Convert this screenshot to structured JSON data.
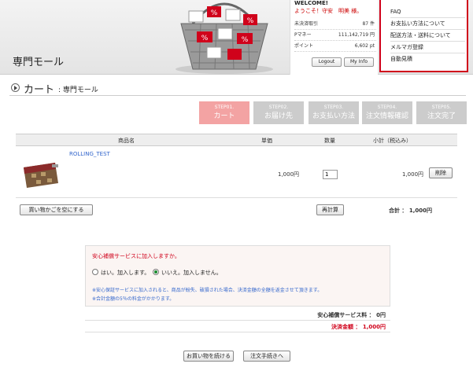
{
  "header": {
    "brand": "専門モール",
    "welcome_title": "WELCOME!",
    "welcome_user": "ようこそ！守安　明美 様。",
    "stats": [
      {
        "label": "未決済取引",
        "value": "87 件"
      },
      {
        "label": "Pマネー",
        "value": "111,142,719 円"
      },
      {
        "label": "ポイント",
        "value": "6,602 pt"
      }
    ],
    "logout_label": "Logout",
    "myinfo_label": "My Info"
  },
  "menu": {
    "items": [
      "FAQ",
      "お支払い方法について",
      "配送方法・送料について",
      "メルマガ登録",
      "自動見積"
    ]
  },
  "page": {
    "title": "カート",
    "subtitle": ": 専門モール"
  },
  "steps": [
    {
      "num": "STEP01.",
      "label": "カート",
      "active": true
    },
    {
      "num": "STEP02.",
      "label": "お届け先",
      "active": false
    },
    {
      "num": "STEP03.",
      "label": "お支払い方法",
      "active": false
    },
    {
      "num": "STEP04.",
      "label": "注文情報確認",
      "active": false
    },
    {
      "num": "STEP05.",
      "label": "注文完了",
      "active": false
    }
  ],
  "cart": {
    "headers": {
      "product": "商品名",
      "price": "単価",
      "qty": "数量",
      "subtotal": "小計（税込み）"
    },
    "item": {
      "name": "ROLLING_TEST",
      "price": "1,000円",
      "qty": "1",
      "subtotal": "1,000円",
      "delete_label": "削除"
    },
    "empty_label": "買い物かごを空にする",
    "recalc_label": "再計算",
    "total": "合計 ： 1,000円"
  },
  "insurance": {
    "question": "安心補償サービスに加入しますか。",
    "yes_label": "はい。加入します。",
    "no_label": "いいえ。加入しません。",
    "selected": "no",
    "note1": "※安心保証サービスに加入されると、商品が紛失、破損された場合、決済金額の全額を返金させて頂きます。",
    "note2": "※合計金額の5％の料金がかかります。",
    "fee": "安心補償サービス料 ： 0円",
    "payment": "決済金額 ： 1,000円"
  },
  "footer": {
    "continue_label": "お買い物を続ける",
    "checkout_label": "注文手続きへ"
  },
  "colors": {
    "accent": "#d0021b",
    "step_active": "#f3a3a3",
    "step_inactive": "#cccccc",
    "link": "#3366cc"
  }
}
